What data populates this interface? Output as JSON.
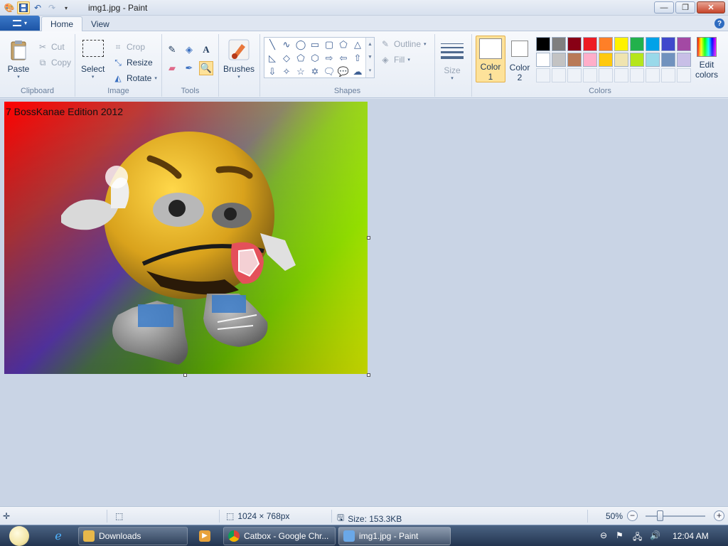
{
  "window": {
    "title": "img1.jpg - Paint"
  },
  "tabs": [
    {
      "label": "Home",
      "active": true
    },
    {
      "label": "View",
      "active": false
    }
  ],
  "ribbon": {
    "clipboard": {
      "label": "Clipboard",
      "paste": "Paste",
      "cut": "Cut",
      "copy": "Copy"
    },
    "image": {
      "label": "Image",
      "select": "Select",
      "crop": "Crop",
      "resize": "Resize",
      "rotate": "Rotate"
    },
    "tools": {
      "label": "Tools",
      "active_tool": "magnifier"
    },
    "brushes": {
      "label": "Brushes"
    },
    "shapes": {
      "label": "Shapes",
      "outline": "Outline",
      "fill": "Fill"
    },
    "size": {
      "label": "Size"
    },
    "colors": {
      "label": "Colors",
      "color1_label": "Color",
      "color1_num": "1",
      "color2_label": "Color",
      "color2_num": "2",
      "color1_value": "#ffffff",
      "color2_value": "#ffffff",
      "edit_label": "Edit",
      "edit_label2": "colors",
      "palette_row1": [
        "#000000",
        "#7f7f7f",
        "#880015",
        "#ed1c24",
        "#ff7f27",
        "#fff200",
        "#22b14c",
        "#00a2e8",
        "#3f48cc",
        "#a349a4"
      ],
      "palette_row2": [
        "#ffffff",
        "#c3c3c3",
        "#b97a57",
        "#ffaec9",
        "#ffc90e",
        "#efe4b0",
        "#b5e61d",
        "#99d9ea",
        "#7092be",
        "#c8bfe7"
      ],
      "palette_row3": [
        "",
        "",
        "",
        "",
        "",
        "",
        "",
        "",
        "",
        ""
      ]
    }
  },
  "canvas": {
    "overlay_text": "7 BossKanae Edition 2012"
  },
  "statusbar": {
    "dimensions": "1024 × 768px",
    "size": "Size: 153.3KB",
    "zoom": "50%"
  },
  "taskbar": {
    "items": [
      {
        "label": "Downloads",
        "icon": "folder-icon",
        "color": "#e8b84a"
      },
      {
        "label": "Catbox - Google Chr...",
        "icon": "chrome-icon",
        "color": "#4a8ee8"
      },
      {
        "label": "img1.jpg - Paint",
        "icon": "paint-icon",
        "color": "#6aa8e8"
      }
    ],
    "clock": "12:04 AM"
  }
}
